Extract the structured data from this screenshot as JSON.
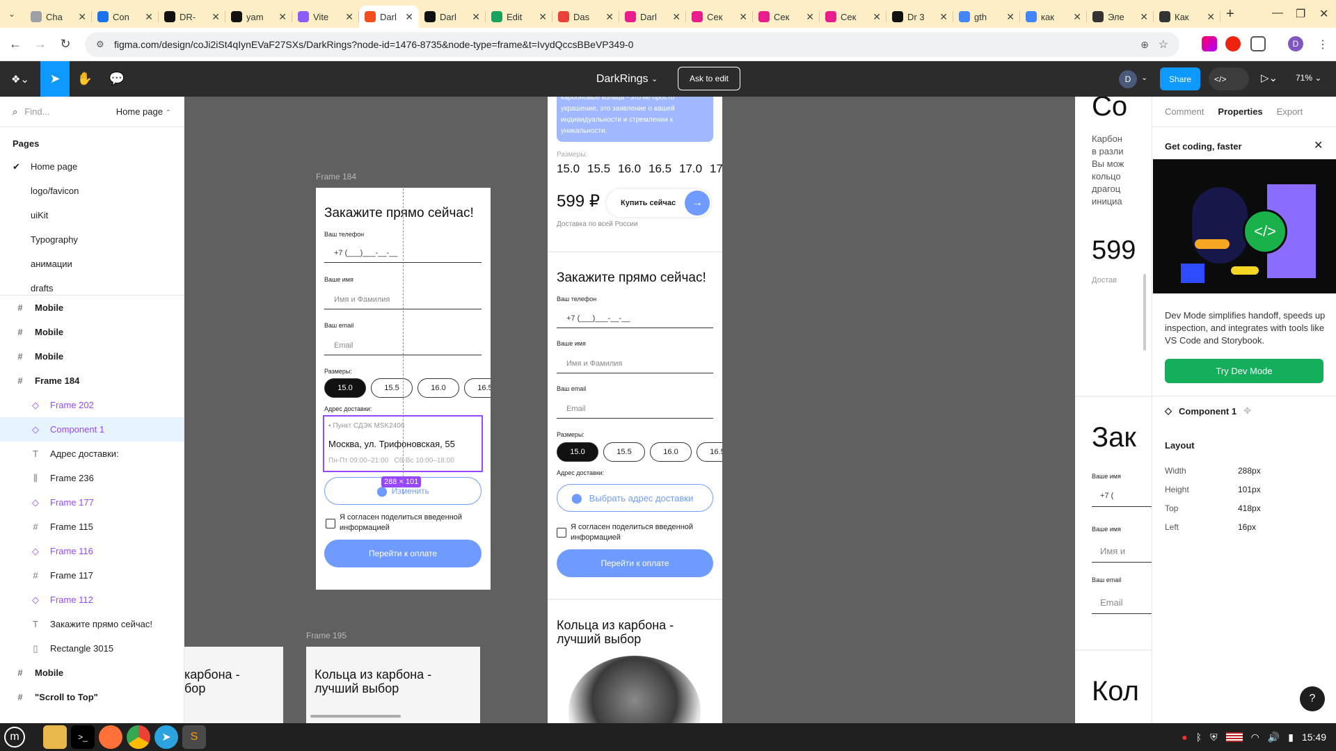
{
  "browser": {
    "tabs": [
      {
        "title": "Cha",
        "fav": "#9aa0a6"
      },
      {
        "title": "Con",
        "fav": "#1a73e8"
      },
      {
        "title": "DR-",
        "fav": "#111111"
      },
      {
        "title": "yam",
        "fav": "#111111"
      },
      {
        "title": "Vite",
        "fav": "#8b5cf6"
      },
      {
        "title": "Darl",
        "fav": "#f24e1e",
        "active": true
      },
      {
        "title": "Darl",
        "fav": "#111111"
      },
      {
        "title": "Edit",
        "fav": "#1aa260"
      },
      {
        "title": "Das",
        "fav": "#ea4335"
      },
      {
        "title": "Darl",
        "fav": "#e91e8c"
      },
      {
        "title": "Сек",
        "fav": "#e91e8c"
      },
      {
        "title": "Сек",
        "fav": "#e91e8c"
      },
      {
        "title": "Сек",
        "fav": "#e91e8c"
      },
      {
        "title": "Dr 3",
        "fav": "#111111"
      },
      {
        "title": "gth",
        "fav": "#4285f4"
      },
      {
        "title": "как",
        "fav": "#4285f4"
      },
      {
        "title": "Эле",
        "fav": "#333333"
      },
      {
        "title": "Как",
        "fav": "#333333"
      }
    ],
    "url": "figma.com/design/coJi2iSt4qIynEVaF27SXs/DarkRings?node-id=1476-8735&node-type=frame&t=IvydQccsBBeVP349-0"
  },
  "figma": {
    "file_name": "DarkRings",
    "ask_to_edit": "Ask to edit",
    "share": "Share",
    "avatar": "D",
    "zoom": "71%"
  },
  "left": {
    "search_placeholder": "Find...",
    "current_page": "Home page",
    "pages_title": "Pages",
    "pages": [
      "Home page",
      "logo/favicon",
      "uiKit",
      "Typography",
      "анимации",
      "drafts"
    ],
    "layers": [
      {
        "name": "Mobile",
        "type": "frame",
        "bold": true
      },
      {
        "name": "Mobile",
        "type": "frame",
        "bold": true
      },
      {
        "name": "Mobile",
        "type": "frame",
        "bold": true
      },
      {
        "name": "Frame 184",
        "type": "frame",
        "bold": true
      },
      {
        "name": "Frame 202",
        "type": "component",
        "ind": true
      },
      {
        "name": "Component 1",
        "type": "component",
        "ind": true,
        "hl": true
      },
      {
        "name": "Адрес доставки:",
        "type": "text",
        "ind": true
      },
      {
        "name": "Frame 236",
        "type": "bars",
        "ind": true
      },
      {
        "name": "Frame 177",
        "type": "component",
        "ind": true
      },
      {
        "name": "Frame 115",
        "type": "frame",
        "ind": true
      },
      {
        "name": "Frame 116",
        "type": "component",
        "ind": true
      },
      {
        "name": "Frame 117",
        "type": "frame",
        "ind": true
      },
      {
        "name": "Frame 112",
        "type": "component",
        "ind": true
      },
      {
        "name": "Закажите прямо сейчас!",
        "type": "text",
        "ind": true
      },
      {
        "name": "Rectangle 3015",
        "type": "rect",
        "ind": true
      },
      {
        "name": "Mobile",
        "type": "frame",
        "bold": true
      },
      {
        "name": "\"Scroll to Top\"",
        "type": "frame",
        "bold": true
      }
    ]
  },
  "canvas": {
    "frame184_label": "Frame 184",
    "frame195_label": "Frame 195",
    "order_title": "Закажите прямо сейчас!",
    "phone_label": "Ваш телефон",
    "phone_mask": "+7 (___)___-__-__",
    "name_label": "Ваше имя",
    "name_placeholder": "Имя и Фамилия",
    "email_label": "Ваш email",
    "email_placeholder": "Email",
    "sizes_label": "Размеры:",
    "sizes": [
      "15.0",
      "15.5",
      "16.0",
      "16.5"
    ],
    "address_label": "Адрес доставки:",
    "pickup_point": "Пункт СДЭК MSK2406",
    "address": "Москва, ул. Трифоновская, 55",
    "hours_weekdays": "Пн-Пт 09:00–21:00",
    "hours_weekend": "Сб-Вс 10:00–18:00",
    "change_btn": "Изменить",
    "dim_badge": "288 × 101",
    "agree": "Я согласен поделиться введенной информацией",
    "pay_btn": "Перейти к оплате",
    "carbon_title": "Кольца из карбона - лучший выбор",
    "carbon_cut": "карбона - бор",
    "mid_intro": "карбоновые кольца - это не просто украшение, это заявление о вашей индивидуальности и стремлении к уникальности.",
    "mid_sizes_label": "Размеры:",
    "mid_sizes": [
      "15.0",
      "15.5",
      "16.0",
      "16.5",
      "17.0",
      "17"
    ],
    "price": "599 ₽",
    "buy_btn": "Купить сейчас",
    "delivery_note": "Доставка по всей России",
    "choose_address": "Выбрать адрес доставки",
    "right_cut": {
      "co": "Co",
      "text": [
        "Карбон",
        "в разли",
        "Вы мож",
        "кольцо",
        "драгоц",
        "инициа"
      ],
      "price": "599",
      "delivery": "Достав",
      "zak": "Зак",
      "phone": "+7 (",
      "name": "Имя и",
      "email": "Email",
      "kol": "Кол",
      "ko2": "кол"
    }
  },
  "right": {
    "tabs": [
      "Comment",
      "Properties",
      "Export"
    ],
    "promo_title": "Get coding, faster",
    "promo_text": "Dev Mode simplifies handoff, speeds up inspection, and integrates with tools like VS Code and Storybook.",
    "promo_btn": "Try Dev Mode",
    "component": "Component 1",
    "layout_title": "Layout",
    "layout": [
      {
        "k": "Width",
        "v": "288px"
      },
      {
        "k": "Height",
        "v": "101px"
      },
      {
        "k": "Top",
        "v": "418px"
      },
      {
        "k": "Left",
        "v": "16px"
      }
    ]
  },
  "taskbar": {
    "time": "15:49"
  }
}
